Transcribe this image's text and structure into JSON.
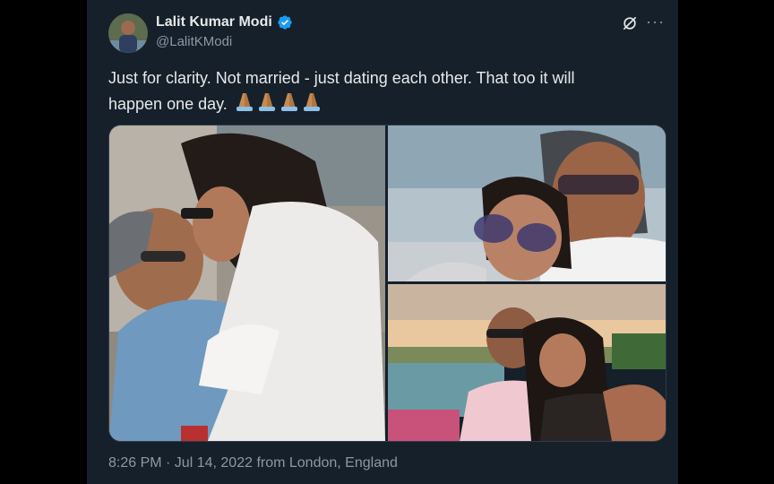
{
  "tweet": {
    "author_name": "Lalit Kumar Modi",
    "author_handle": "@LalitKModi",
    "text_line1": "Just for clarity. Not married - just dating each other. That too it will",
    "text_line2": "happen one day.",
    "emoji_count": 4,
    "icons": {
      "verified": "verified-badge-icon",
      "grok": "grok-icon",
      "more": "more-options-icon",
      "emoji": "folded-hands-emoji"
    },
    "timestamp": "8:26 PM · Jul 14, 2022",
    "location": "from London, England",
    "more_label": "···"
  },
  "colors": {
    "background": "#15202b",
    "text": "#e7e9ea",
    "secondary": "#8b98a5",
    "verified": "#1d9bf0"
  }
}
